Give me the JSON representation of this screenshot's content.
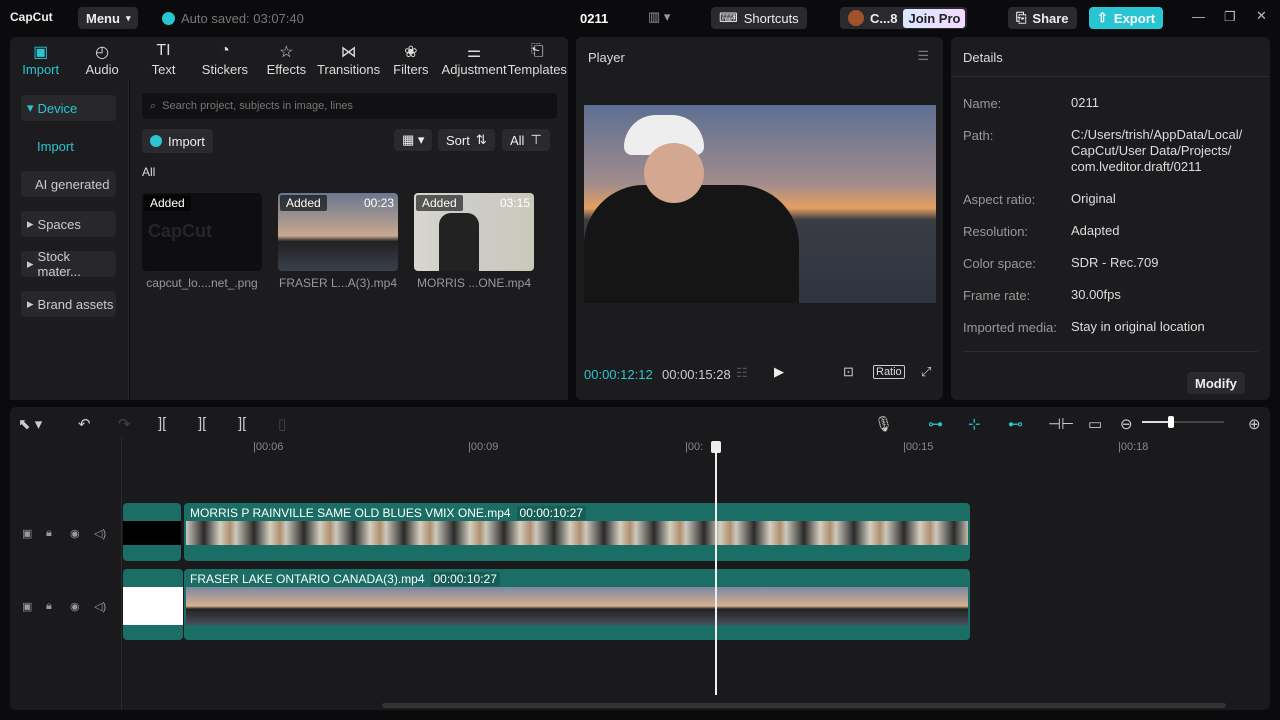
{
  "app": {
    "logo": "CapCut",
    "menu": "Menu",
    "autosave": "Auto saved: 03:07:40",
    "project": "0211",
    "shortcuts": "Shortcuts",
    "user": "C...8",
    "join_pro": "Join Pro",
    "share": "Share",
    "export": "Export",
    "accent": "#29c5d3"
  },
  "tabs": [
    {
      "label": "Import",
      "icon": "import-icon"
    },
    {
      "label": "Audio",
      "icon": "audio-icon"
    },
    {
      "label": "Text",
      "icon": "text-icon"
    },
    {
      "label": "Stickers",
      "icon": "sticker-icon"
    },
    {
      "label": "Effects",
      "icon": "effects-icon"
    },
    {
      "label": "Transitions",
      "icon": "transitions-icon"
    },
    {
      "label": "Filters",
      "icon": "filters-icon"
    },
    {
      "label": "Adjustment",
      "icon": "adjustment-icon"
    },
    {
      "label": "Templates",
      "icon": "templates-icon"
    }
  ],
  "sidebar": {
    "items": [
      "Device",
      "Import",
      "AI generated",
      "Spaces",
      "Stock mater...",
      "Brand assets"
    ]
  },
  "media": {
    "search_placeholder": "Search project, subjects in image, lines",
    "import": "Import",
    "sort": "Sort",
    "all_filter": "All",
    "section": "All",
    "items": [
      {
        "badge": "Added",
        "duration": "",
        "name": "capcut_lo....net_.png"
      },
      {
        "badge": "Added",
        "duration": "00:23",
        "name": "FRASER L...A(3).mp4"
      },
      {
        "badge": "Added",
        "duration": "03:15",
        "name": "MORRIS ...ONE.mp4"
      }
    ]
  },
  "player": {
    "title": "Player",
    "current": "00:00:12:12",
    "total": "00:00:15:28",
    "ratio": "Ratio"
  },
  "details": {
    "title": "Details",
    "rows": [
      {
        "label": "Name:",
        "value": "0211"
      },
      {
        "label": "Path:",
        "value": "C:/Users/trish/AppData/Local/ CapCut/User Data/Projects/ com.lveditor.draft/0211"
      },
      {
        "label": "Aspect ratio:",
        "value": "Original"
      },
      {
        "label": "Resolution:",
        "value": "Adapted"
      },
      {
        "label": "Color space:",
        "value": "SDR - Rec.709"
      },
      {
        "label": "Frame rate:",
        "value": "30.00fps"
      },
      {
        "label": "Imported media:",
        "value": "Stay in original location"
      }
    ],
    "modify": "Modify"
  },
  "timeline": {
    "ruler": [
      "|00:06",
      "|00:09",
      "|00:",
      "|00:15",
      "|00:18"
    ],
    "clips": [
      {
        "name": "MORRIS P RAINVILLE SAME OLD BLUES VMIX ONE.mp4",
        "duration": "00:00:10:27"
      },
      {
        "name": "FRASER LAKE ONTARIO CANADA(3).mp4",
        "duration": "00:00:10:27"
      }
    ],
    "zoom_level": 0.1
  }
}
